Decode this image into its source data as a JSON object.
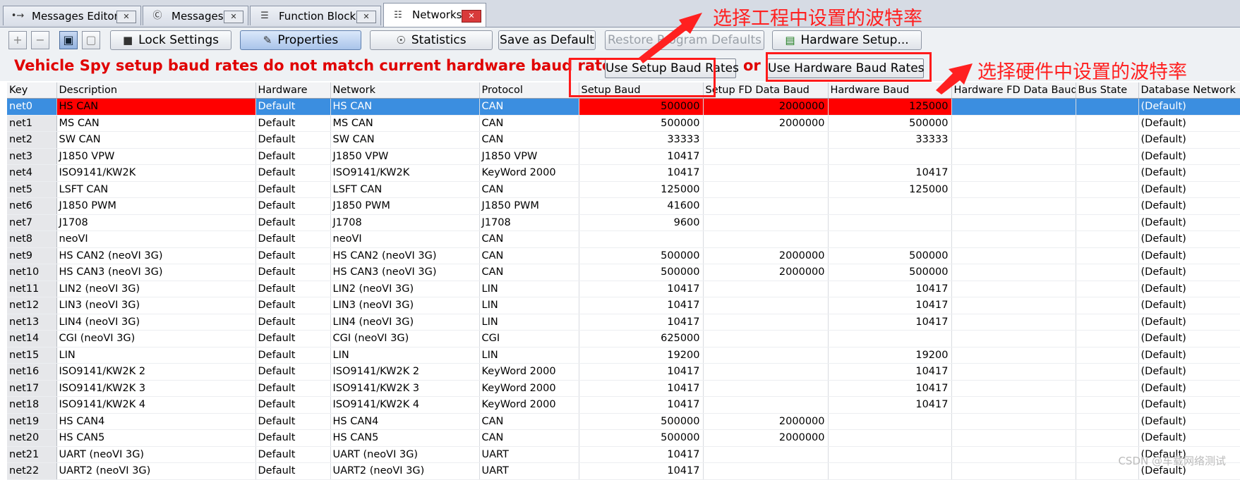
{
  "tabs": [
    {
      "label": "Messages Editor",
      "icon": "message-editor-icon",
      "active": false
    },
    {
      "label": "Messages",
      "icon": "messages-icon",
      "active": false
    },
    {
      "label": "Function Blocks",
      "icon": "function-blocks-icon",
      "active": false
    },
    {
      "label": "Networks",
      "icon": "network-tree-icon",
      "active": true
    }
  ],
  "toolbar": {
    "add_icon": "+",
    "remove_icon": "−",
    "lock_settings": "Lock Settings",
    "properties": "Properties",
    "statistics": "Statistics",
    "save_as_default": "Save as Default",
    "restore_program_defaults": "Restore Program Defaults",
    "hardware_setup": "Hardware Setup..."
  },
  "warning": {
    "text": "Vehicle Spy setup baud rates do not match current hardware baud rates",
    "or": "or",
    "use_setup": "Use Setup Baud Rates",
    "use_hardware": "Use Hardware Baud Rates"
  },
  "annotations": {
    "top": "选择工程中设置的波特率",
    "right": "选择硬件中设置的波特率",
    "color": "#ff2020"
  },
  "watermark": "CSDN @车载网络测试",
  "table": {
    "columns": [
      "Key",
      "Description",
      "Hardware",
      "Network",
      "Protocol",
      "Setup Baud",
      "Setup FD Data Baud",
      "Hardware Baud",
      "Hardware FD Data Baud",
      "Bus State",
      "Database Network"
    ],
    "rows": [
      [
        "net0",
        "HS CAN",
        "Default",
        "HS CAN",
        "CAN",
        "500000",
        "2000000",
        "125000",
        "",
        "",
        "(Default)"
      ],
      [
        "net1",
        "MS CAN",
        "Default",
        "MS CAN",
        "CAN",
        "500000",
        "2000000",
        "500000",
        "",
        "",
        "(Default)"
      ],
      [
        "net2",
        "SW CAN",
        "Default",
        "SW CAN",
        "CAN",
        "33333",
        "",
        "33333",
        "",
        "",
        "(Default)"
      ],
      [
        "net3",
        "J1850 VPW",
        "Default",
        "J1850 VPW",
        "J1850 VPW",
        "10417",
        "",
        "",
        "",
        "",
        "(Default)"
      ],
      [
        "net4",
        "ISO9141/KW2K",
        "Default",
        "ISO9141/KW2K",
        "KeyWord 2000",
        "10417",
        "",
        "10417",
        "",
        "",
        "(Default)"
      ],
      [
        "net5",
        "LSFT CAN",
        "Default",
        "LSFT CAN",
        "CAN",
        "125000",
        "",
        "125000",
        "",
        "",
        "(Default)"
      ],
      [
        "net6",
        "J1850 PWM",
        "Default",
        "J1850 PWM",
        "J1850 PWM",
        "41600",
        "",
        "",
        "",
        "",
        "(Default)"
      ],
      [
        "net7",
        "J1708",
        "Default",
        "J1708",
        "J1708",
        "9600",
        "",
        "",
        "",
        "",
        "(Default)"
      ],
      [
        "net8",
        "neoVI",
        "Default",
        "neoVI",
        "CAN",
        "",
        "",
        "",
        "",
        "",
        "(Default)"
      ],
      [
        "net9",
        "HS CAN2 (neoVI 3G)",
        "Default",
        "HS CAN2 (neoVI 3G)",
        "CAN",
        "500000",
        "2000000",
        "500000",
        "",
        "",
        "(Default)"
      ],
      [
        "net10",
        "HS CAN3 (neoVI 3G)",
        "Default",
        "HS CAN3 (neoVI 3G)",
        "CAN",
        "500000",
        "2000000",
        "500000",
        "",
        "",
        "(Default)"
      ],
      [
        "net11",
        "LIN2 (neoVI 3G)",
        "Default",
        "LIN2 (neoVI 3G)",
        "LIN",
        "10417",
        "",
        "10417",
        "",
        "",
        "(Default)"
      ],
      [
        "net12",
        "LIN3 (neoVI 3G)",
        "Default",
        "LIN3 (neoVI 3G)",
        "LIN",
        "10417",
        "",
        "10417",
        "",
        "",
        "(Default)"
      ],
      [
        "net13",
        "LIN4 (neoVI 3G)",
        "Default",
        "LIN4 (neoVI 3G)",
        "LIN",
        "10417",
        "",
        "10417",
        "",
        "",
        "(Default)"
      ],
      [
        "net14",
        "CGI (neoVI 3G)",
        "Default",
        "CGI (neoVI 3G)",
        "CGI",
        "625000",
        "",
        "",
        "",
        "",
        "(Default)"
      ],
      [
        "net15",
        "LIN",
        "Default",
        "LIN",
        "LIN",
        "19200",
        "",
        "19200",
        "",
        "",
        "(Default)"
      ],
      [
        "net16",
        "ISO9141/KW2K 2",
        "Default",
        "ISO9141/KW2K 2",
        "KeyWord 2000",
        "10417",
        "",
        "10417",
        "",
        "",
        "(Default)"
      ],
      [
        "net17",
        "ISO9141/KW2K 3",
        "Default",
        "ISO9141/KW2K 3",
        "KeyWord 2000",
        "10417",
        "",
        "10417",
        "",
        "",
        "(Default)"
      ],
      [
        "net18",
        "ISO9141/KW2K 4",
        "Default",
        "ISO9141/KW2K 4",
        "KeyWord 2000",
        "10417",
        "",
        "10417",
        "",
        "",
        "(Default)"
      ],
      [
        "net19",
        "HS CAN4",
        "Default",
        "HS CAN4",
        "CAN",
        "500000",
        "2000000",
        "",
        "",
        "",
        "(Default)"
      ],
      [
        "net20",
        "HS CAN5",
        "Default",
        "HS CAN5",
        "CAN",
        "500000",
        "2000000",
        "",
        "",
        "",
        "(Default)"
      ],
      [
        "net21",
        "UART (neoVI 3G)",
        "Default",
        "UART (neoVI 3G)",
        "UART",
        "10417",
        "",
        "",
        "",
        "",
        "(Default)"
      ],
      [
        "net22",
        "UART2 (neoVI 3G)",
        "Default",
        "UART2 (neoVI 3G)",
        "UART",
        "10417",
        "",
        "",
        "",
        "",
        "(Default)"
      ]
    ]
  }
}
